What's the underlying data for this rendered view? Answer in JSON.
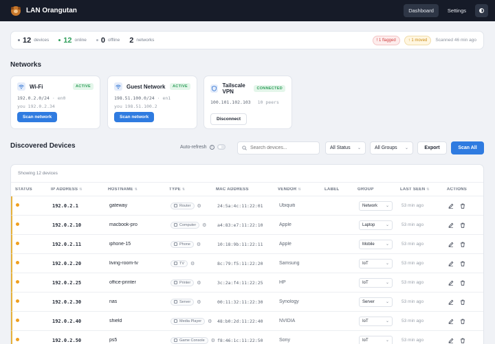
{
  "app": {
    "title": "LAN Orangutan"
  },
  "nav": {
    "dashboard": "Dashboard",
    "settings": "Settings"
  },
  "summary": {
    "devices": {
      "num": "12",
      "label": "devices"
    },
    "online": {
      "num": "12",
      "label": "online"
    },
    "offline": {
      "num": "0",
      "label": "offline"
    },
    "networks": {
      "num": "2",
      "label": "networks"
    },
    "flagged": "! 1 flagged",
    "moved": "↑ 1 moved",
    "scanned": "Scanned 46 min ago"
  },
  "networks": {
    "title": "Networks",
    "cards": [
      {
        "name": "Wi-Fi",
        "badge": "ACTIVE",
        "line1": "192.0.2.0/24",
        "line1b": "· en0",
        "line2a": "you",
        "line2b": "192.0.2.34",
        "button": "Scan network"
      },
      {
        "name": "Guest Network",
        "badge": "ACTIVE",
        "line1": "198.51.100.0/24",
        "line1b": "· en1",
        "line2a": "you",
        "line2b": "198.51.100.2",
        "button": "Scan network"
      },
      {
        "name": "Tailscale VPN",
        "badge": "CONNECTED",
        "line1": "100.101.102.103",
        "line1b": "10 peers",
        "button": "Disconnect"
      }
    ]
  },
  "devices": {
    "title": "Discovered Devices",
    "auto_refresh": "Auto-refresh",
    "search_placeholder": "Search devices...",
    "status_filter": "All Status",
    "group_filter": "All Groups",
    "export": "Export",
    "scan_all": "Scan All",
    "showing": "Showing 12 devices",
    "columns": [
      "STATUS",
      "IP ADDRESS",
      "HOSTNAME",
      "TYPE",
      "MAC ADDRESS",
      "VENDOR",
      "LABEL",
      "GROUP",
      "LAST SEEN",
      "ACTIONS"
    ],
    "rows": [
      {
        "ip": "192.0.2.1",
        "host": "gateway",
        "type": "Router",
        "mac": "24:5a:4c:11:22:01",
        "vendor": "Ubiquiti",
        "group": "Network",
        "seen": "53 min ago"
      },
      {
        "ip": "192.0.2.10",
        "host": "macbook-pro",
        "type": "Computer",
        "mac": "a4:83:e7:11:22:10",
        "vendor": "Apple",
        "group": "Laptop",
        "seen": "53 min ago"
      },
      {
        "ip": "192.0.2.11",
        "host": "iphone-15",
        "type": "Phone",
        "mac": "10:18:9b:11:22:11",
        "vendor": "Apple",
        "group": "Mobile",
        "seen": "53 min ago"
      },
      {
        "ip": "192.0.2.20",
        "host": "living-room-tv",
        "type": "TV",
        "mac": "8c:79:f5:11:22:20",
        "vendor": "Samsung",
        "group": "IoT",
        "seen": "53 min ago"
      },
      {
        "ip": "192.0.2.25",
        "host": "office-printer",
        "type": "Printer",
        "mac": "3c:2a:f4:11:22:25",
        "vendor": "HP",
        "group": "IoT",
        "seen": "53 min ago"
      },
      {
        "ip": "192.0.2.30",
        "host": "nas",
        "type": "Server",
        "mac": "00:11:32:11:22:30",
        "vendor": "Synology",
        "group": "Server",
        "seen": "53 min ago"
      },
      {
        "ip": "192.0.2.40",
        "host": "shield",
        "type": "Media Player",
        "mac": "48:b0:2d:11:22:40",
        "vendor": "NVIDIA",
        "group": "IoT",
        "seen": "53 min ago"
      },
      {
        "ip": "192.0.2.50",
        "host": "ps5",
        "type": "Game Console",
        "mac": "f8:46:1c:11:22:50",
        "vendor": "Sony",
        "group": "IoT",
        "seen": "53 min ago"
      }
    ]
  },
  "colors": {
    "accent": "#2f7be0",
    "warning": "#f0a020",
    "online": "#2f9e5a",
    "topbar": "#161b28"
  }
}
